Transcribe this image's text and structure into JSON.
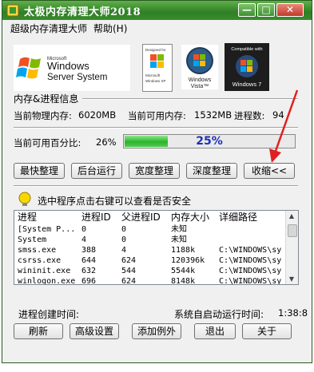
{
  "window": {
    "title": "太极内存清理大师2018",
    "controls": {
      "minimize": "—",
      "restore": "□",
      "close": "✕"
    },
    "accent": "#3b8b2d"
  },
  "menu": {
    "items": [
      {
        "label": "超级内存清理大师"
      },
      {
        "label": "帮助(H)"
      }
    ]
  },
  "logos": {
    "windows_server": {
      "small": "Microsoft",
      "line1": "Windows",
      "line2": "Server System"
    },
    "xp_badge": {
      "line1": "Designed for",
      "line2": "Microsoft",
      "line3": "Windows XP"
    },
    "vista_badge": {
      "line1": "Windows",
      "line2": "Vista™"
    },
    "win7_badge": {
      "top": "Compatible with",
      "bottom": "Windows 7"
    }
  },
  "info": {
    "group_title": "内存&进程信息",
    "physical_label": "当前物理内存:",
    "physical_value": "6020MB",
    "available_label": "当前可用内存:",
    "available_value": "1532MB",
    "process_label": "进程数:",
    "process_value": "94"
  },
  "usage": {
    "label": "当前可用百分比:",
    "value": "26%",
    "progress_text": "25%",
    "progress_fraction": 0.25
  },
  "actions": {
    "fastest": "最快整理",
    "background": "后台运行",
    "broad": "宽度整理",
    "deep": "深度整理",
    "collapse": "收缩<<"
  },
  "hint": "选中程序点击右键可以查看是否安全",
  "table": {
    "headers": [
      "进程",
      "进程ID",
      "父进程ID",
      "内存大小",
      "详细路径"
    ],
    "rows": [
      [
        "[System P...",
        "0",
        "0",
        "未知",
        ""
      ],
      [
        "System",
        "4",
        "0",
        "未知",
        ""
      ],
      [
        "smss.exe",
        "388",
        "4",
        "1188k",
        "C:\\WINDOWS\\sy"
      ],
      [
        "csrss.exe",
        "644",
        "624",
        "120396k",
        "C:\\WINDOWS\\sy"
      ],
      [
        "wininit.exe",
        "632",
        "544",
        "5544k",
        "C:\\WINDOWS\\sy"
      ],
      [
        "winlogon.exe",
        "696",
        "624",
        "8148k",
        "C:\\WINDOWS\\sy"
      ]
    ]
  },
  "footer": {
    "created_label": "进程创建时间:",
    "uptime_label": "系统自启动运行时间:",
    "uptime_value": "1:38:8"
  },
  "bottom_buttons": {
    "refresh": "刷新",
    "advanced": "高级设置",
    "exclude": "添加例外",
    "exit": "退出",
    "about": "关于"
  },
  "annotation": {
    "color": "#e02020"
  }
}
